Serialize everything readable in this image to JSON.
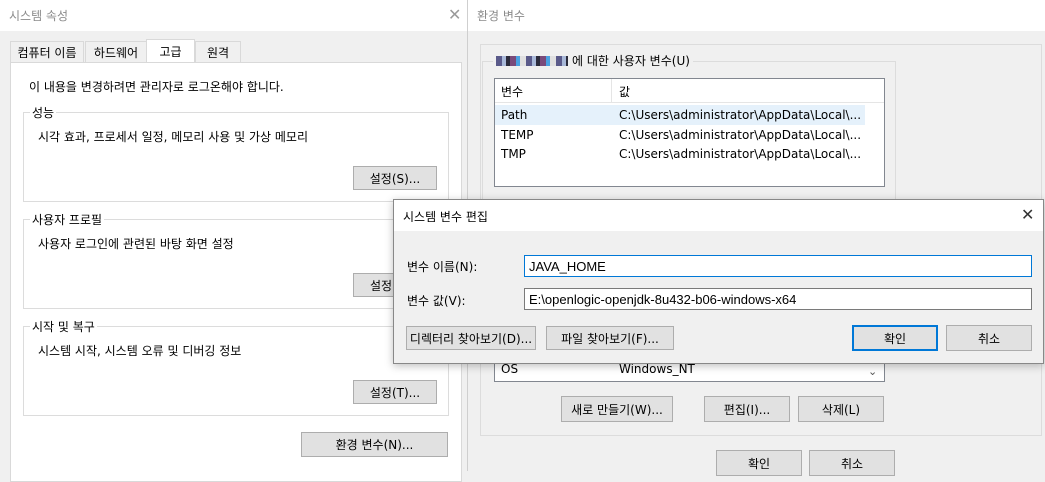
{
  "sysprops": {
    "title": "시스템 속성",
    "tabs": [
      "컴퓨터 이름",
      "하드웨어",
      "고급",
      "원격"
    ],
    "admin_note": "이 내용을 변경하려면 관리자로 로그온해야 합니다.",
    "performance": {
      "label": "성능",
      "desc": "시각 효과, 프로세서 일정, 메모리 사용 및 가상 메모리",
      "button": "설정(S)..."
    },
    "profile": {
      "label": "사용자 프로필",
      "desc": "사용자 로그인에 관련된 바탕 화면 설정",
      "button": "설정"
    },
    "startup": {
      "label": "시작 및 복구",
      "desc": "시스템 시작, 시스템 오류 및 디버깅 정보",
      "button": "설정(T)..."
    },
    "env_button": "환경 변수(N)..."
  },
  "envvars": {
    "title": "환경 변수",
    "user_group_label": "에 대한 사용자 변수(U)",
    "columns": {
      "name": "변수",
      "value": "값"
    },
    "user_vars": [
      {
        "name": "Path",
        "value": "C:\\Users\\administrator\\AppData\\Local\\..."
      },
      {
        "name": "TEMP",
        "value": "C:\\Users\\administrator\\AppData\\Local\\..."
      },
      {
        "name": "TMP",
        "value": "C:\\Users\\administrator\\AppData\\Local\\..."
      }
    ],
    "sys_partial_row": {
      "name": "OS",
      "value": "Windows_NT"
    },
    "buttons": {
      "new": "새로 만들기(W)...",
      "edit": "편집(I)...",
      "delete": "삭제(L)"
    },
    "ok": "확인",
    "cancel": "취소"
  },
  "editdlg": {
    "title": "시스템 변수 편집",
    "name_label": "변수 이름(N):",
    "name_value": "JAVA_HOME",
    "value_label": "변수 값(V):",
    "value_value": "E:\\openlogic-openjdk-8u432-b06-windows-x64",
    "browse_dir": "디렉터리 찾아보기(D)...",
    "browse_file": "파일 찾아보기(F)...",
    "ok": "확인",
    "cancel": "취소"
  },
  "colors": {
    "accent": "#0078d7",
    "selection": "#e5f1fb",
    "button_bg": "#e1e1e1"
  }
}
